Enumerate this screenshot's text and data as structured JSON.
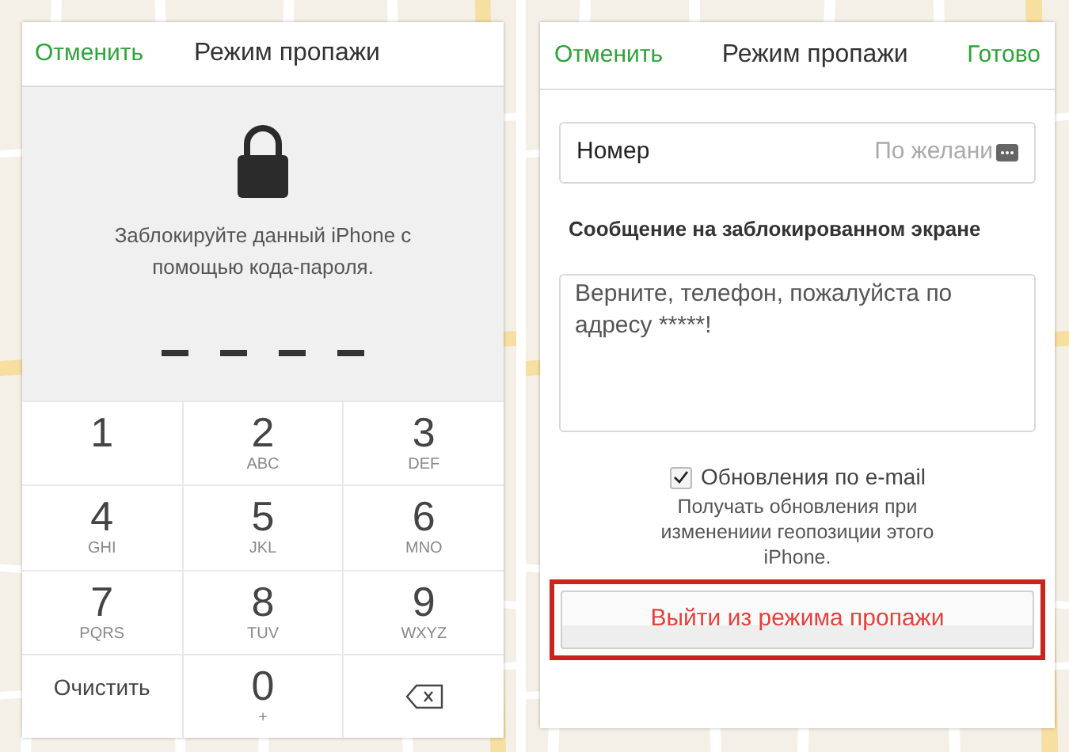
{
  "lock_panel": {
    "header": {
      "cancel": "Отменить",
      "title": "Режим пропажи"
    },
    "instruction": "Заблокируйте данный iPhone с помощью кода-пароля.",
    "passcode": [
      {
        "filled": false
      },
      {
        "filled": false
      },
      {
        "filled": false
      },
      {
        "filled": false
      }
    ],
    "keypad": [
      {
        "kind": "digit",
        "digit": "1"
      },
      {
        "kind": "digit",
        "digit": "2",
        "letters": "ABC"
      },
      {
        "kind": "digit",
        "digit": "3",
        "letters": "DEF"
      },
      {
        "kind": "digit",
        "digit": "4",
        "letters": "GHI"
      },
      {
        "kind": "digit",
        "digit": "5",
        "letters": "JKL"
      },
      {
        "kind": "digit",
        "digit": "6",
        "letters": "MNO"
      },
      {
        "kind": "digit",
        "digit": "7",
        "letters": "PQRS"
      },
      {
        "kind": "digit",
        "digit": "8",
        "letters": "TUV"
      },
      {
        "kind": "digit",
        "digit": "9",
        "letters": "WXYZ"
      },
      {
        "kind": "text",
        "label": "Очистить"
      },
      {
        "kind": "digit",
        "digit": "0",
        "letters": "+"
      },
      {
        "kind": "delete"
      }
    ]
  },
  "message_panel": {
    "header": {
      "cancel": "Отменить",
      "title": "Режим пропажи",
      "done": "Готово"
    },
    "number_field": {
      "label": "Номер",
      "placeholder": "По желани"
    },
    "message_label": "Сообщение на заблокированном экране",
    "message": "Верните, телефон, пожалуйста по адресу *****!",
    "email_updates": {
      "label": "Обновления по e-mail",
      "checked": true,
      "description": "Получать обновления при изменениии геопозиции этого iPhone."
    },
    "exit_button": {
      "label": "Выйти из режима пропажи",
      "highlighted": true
    }
  }
}
